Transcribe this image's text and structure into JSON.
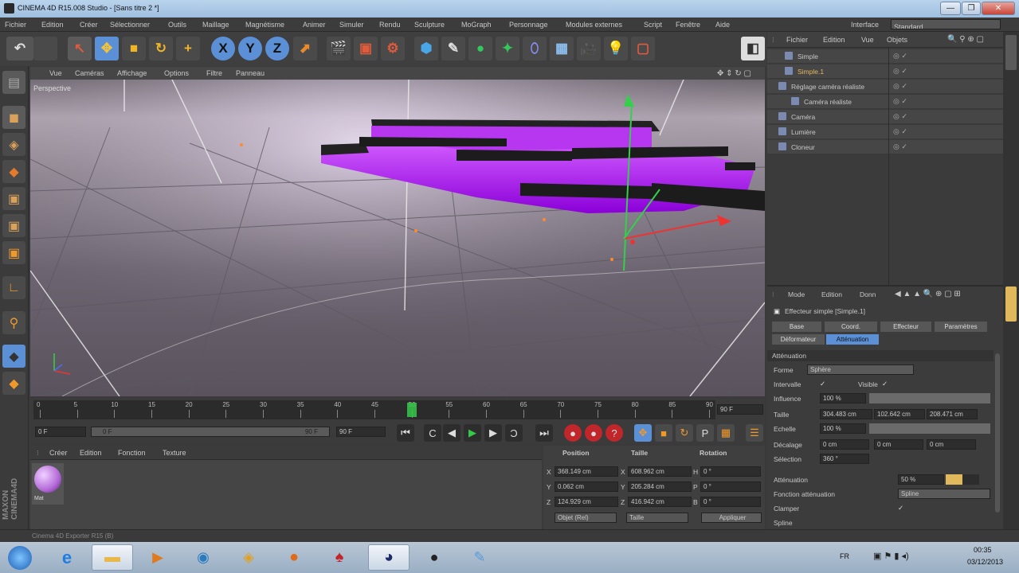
{
  "window": {
    "title": "CINEMA 4D R15.008 Studio - [Sans titre 2 *]",
    "buttons": [
      "—",
      "❐",
      "✕"
    ]
  },
  "menubar": {
    "items": [
      "Fichier",
      "Edition",
      "Créer",
      "Sélectionner",
      "Outils",
      "Maillage",
      "Magnétisme",
      "Animer",
      "Simuler",
      "Rendu",
      "Sculpture",
      "MoGraph",
      "Personnage",
      "Modules externes",
      "Script",
      "Fenêtre",
      "Aide"
    ],
    "interface_label": "Interface",
    "interface_value": "Standard"
  },
  "toolbar": {
    "axes": [
      "X",
      "Y",
      "Z"
    ]
  },
  "viewport": {
    "menu": [
      "Vue",
      "Caméras",
      "Affichage",
      "Options",
      "Filtre",
      "Panneau"
    ],
    "label": "Perspective"
  },
  "timeline": {
    "ticks": [
      "0",
      "5",
      "10",
      "15",
      "20",
      "25",
      "30",
      "35",
      "40",
      "45",
      "50",
      "55",
      "60",
      "65",
      "70",
      "75",
      "80",
      "85",
      "90"
    ],
    "end_field": "90 F",
    "current_frame": 50
  },
  "transport": {
    "start": "0 F",
    "range_start": "0 F",
    "range_end": "90 F",
    "end": "90 F"
  },
  "material": {
    "menu": [
      "Créer",
      "Edition",
      "Fonction",
      "Texture"
    ],
    "swatch_label": "Mat",
    "swatch_color": "#b36ad8"
  },
  "coords": {
    "headers": [
      "Position",
      "Taille",
      "Rotation"
    ],
    "rows": [
      {
        "axis": "X",
        "pos": "368.149 cm",
        "size_axis": "X",
        "size": "608.962 cm",
        "rot_axis": "H",
        "rot": "0 °"
      },
      {
        "axis": "Y",
        "pos": "0.062 cm",
        "size_axis": "Y",
        "size": "205.284 cm",
        "rot_axis": "P",
        "rot": "0 °"
      },
      {
        "axis": "Z",
        "pos": "124.929 cm",
        "size_axis": "Z",
        "size": "416.942 cm",
        "rot_axis": "B",
        "rot": "0 °"
      }
    ],
    "mode": "Objet (Rel)",
    "size_mode": "Taille",
    "apply": "Appliquer"
  },
  "objects": {
    "menu": [
      "Fichier",
      "Edition",
      "Vue",
      "Objets"
    ],
    "items": [
      {
        "name": "Simple",
        "indent": 1,
        "highlight": false
      },
      {
        "name": "Simple.1",
        "indent": 1,
        "highlight": true
      },
      {
        "name": "Réglage caméra réaliste",
        "indent": 0,
        "highlight": false
      },
      {
        "name": "Caméra réaliste",
        "indent": 2,
        "highlight": false
      },
      {
        "name": "Caméra",
        "indent": 0,
        "highlight": false
      },
      {
        "name": "Lumière",
        "indent": 0,
        "highlight": false
      },
      {
        "name": "Cloneur",
        "indent": 0,
        "highlight": false
      }
    ]
  },
  "attributes": {
    "menu": [
      "Mode",
      "Edition",
      "Donn"
    ],
    "title": "Effecteur simple [Simple.1]",
    "tabs": [
      "Base",
      "Coord.",
      "Effecteur",
      "Paramètres"
    ],
    "tabs2": [
      "Déformateur",
      "Atténuation"
    ],
    "section": "Atténuation",
    "forme_label": "Forme",
    "forme_value": "Sphère",
    "invisible_label": "Intervalle",
    "visible_label": "Visible",
    "influence_label": "Influence",
    "influence_value": "100 %",
    "influence_pct": 100,
    "taille_label": "Taille",
    "taille_values": [
      "304.483 cm",
      "102.642 cm",
      "208.471 cm"
    ],
    "echelle_label": "Echelle",
    "echelle_value": "100 %",
    "decalage_label": "Décalage",
    "decalage_values": [
      "0 cm",
      "0 cm",
      "0 cm"
    ],
    "selection_label": "Sélection",
    "selection_value": "360 °",
    "attenuation_label": "Atténuation",
    "attenuation_value": "50 %",
    "attenuation_pct": 50,
    "fonction_label": "Fonction atténuation",
    "fonction_value": "Spline",
    "clamper_label": "Clamper",
    "spline_label": "Spline"
  },
  "statusbar": {
    "text": "Cinema 4D Exporter R15 (B)"
  },
  "taskbar": {
    "lang": "FR",
    "time": "00:35",
    "date": "03/12/2013"
  },
  "colors": {
    "accent": "#e0b95c",
    "purple": "#b020f0",
    "selection": "#5b8fd6"
  }
}
